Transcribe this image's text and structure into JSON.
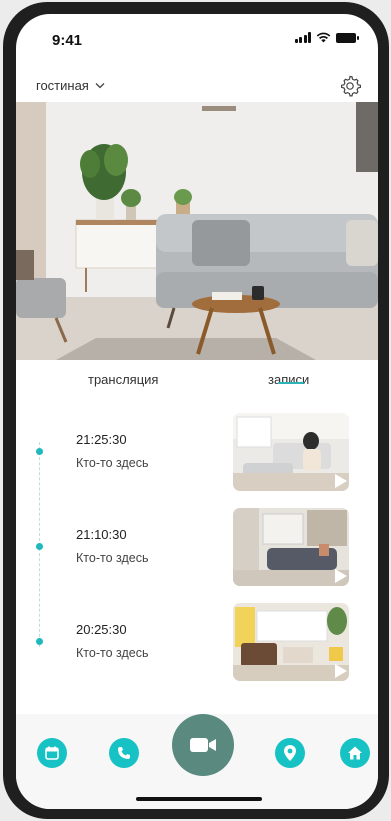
{
  "status_bar": {
    "time": "9:41"
  },
  "header": {
    "room": "гостиная",
    "dropdown_icon": "chevron-down-icon",
    "settings_icon": "gear-icon"
  },
  "tabs": {
    "live": "трансляция",
    "records": "записи",
    "active": "records"
  },
  "records": [
    {
      "time": "21:25:30",
      "description": "Кто-то здесь"
    },
    {
      "time": "21:10:30",
      "description": "Кто-то здесь"
    },
    {
      "time": "20:25:30",
      "description": "Кто-то здесь"
    }
  ],
  "bottom_nav": {
    "items": [
      "calendar-icon",
      "phone-icon",
      "video-camera-icon",
      "location-pin-icon",
      "home-icon"
    ]
  },
  "colors": {
    "accent": "#17c2c4",
    "video_button": "#5a8a7f",
    "frame": "#1f1f1f"
  }
}
